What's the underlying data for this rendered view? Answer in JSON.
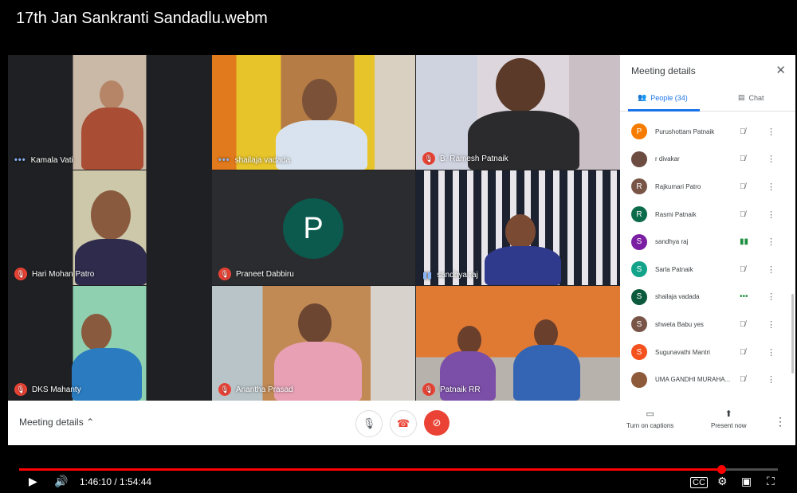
{
  "video": {
    "title": "17th Jan Sankranti Sandadlu.webm",
    "time_display": "1:46:10 / 1:54:44",
    "progress_fraction": 0.9254
  },
  "tiles": [
    {
      "name": "Kamala Vati",
      "status": "dots"
    },
    {
      "name": "shailaja vadada",
      "status": "dots"
    },
    {
      "name": "B. Ramesh Patnaik",
      "status": "muted"
    },
    {
      "name": "Hari Mohan Patro",
      "status": "muted"
    },
    {
      "name": "Praneet Dabbiru",
      "status": "muted",
      "avatar_letter": "P"
    },
    {
      "name": "sandhya raj",
      "status": "speaking"
    },
    {
      "name": "DKS Mahanty",
      "status": "muted"
    },
    {
      "name": "Anantha Prasad",
      "status": "muted"
    },
    {
      "name": "Patnaik RR",
      "status": "muted"
    }
  ],
  "panel": {
    "title": "Meeting details",
    "tab_people": "People (34)",
    "tab_chat": "Chat",
    "participants": [
      {
        "initial": "P",
        "name": "Purushottam Patnaik",
        "color": "#f57c00",
        "mic": "muted"
      },
      {
        "initial": "",
        "name": "r divakar",
        "color": "#6d4c41",
        "mic": "muted"
      },
      {
        "initial": "R",
        "name": "Rajkumari Patro",
        "color": "#795548",
        "mic": "muted"
      },
      {
        "initial": "R",
        "name": "Rasmi Patnaik",
        "color": "#0b6b4a",
        "mic": "muted"
      },
      {
        "initial": "S",
        "name": "sandhya raj",
        "color": "#7b1fa2",
        "mic": "speaking"
      },
      {
        "initial": "S",
        "name": "Sarla Patnaik",
        "color": "#12a38a",
        "mic": "muted"
      },
      {
        "initial": "S",
        "name": "shailaja vadada",
        "color": "#0b5a3e",
        "mic": "dots"
      },
      {
        "initial": "S",
        "name": "shweta Babu yes",
        "color": "#795548",
        "mic": "muted"
      },
      {
        "initial": "S",
        "name": "Sugunavathi Mantri",
        "color": "#f4511e",
        "mic": "muted"
      },
      {
        "initial": "",
        "name": "UMA GANDHI MURAHA...",
        "color": "#8d5a3a",
        "mic": "muted"
      }
    ]
  },
  "bottom": {
    "meeting_details": "Meeting details",
    "captions": "Turn on captions",
    "present": "Present now"
  },
  "colors": {
    "accent": "#1a73e8",
    "danger": "#ea4335",
    "progress": "#ff0000"
  }
}
